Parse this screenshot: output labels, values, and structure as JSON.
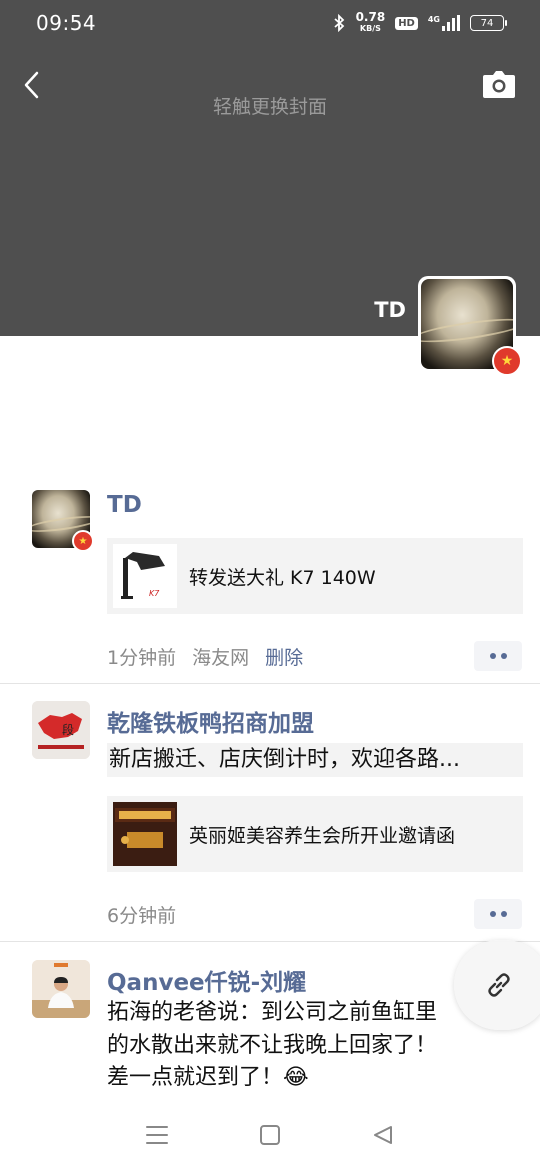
{
  "status_bar": {
    "time": "09:54",
    "net_speed_value": "0.78",
    "net_speed_unit": "KB/S",
    "hd_label": "HD",
    "network_label": "4G",
    "battery": "74"
  },
  "cover": {
    "hint": "轻触更换封面",
    "owner_name": "TD"
  },
  "posts": [
    {
      "author": "TD",
      "share_title": "转发送大礼 K7 140W",
      "time": "1分钟前",
      "source": "海友网",
      "delete_label": "删除"
    },
    {
      "author": "乾隆铁板鸭招商加盟",
      "text": "新店搬迁、店庆倒计时，欢迎各路...",
      "share_title": "英丽姬美容养生会所开业邀请函",
      "time": "6分钟前"
    },
    {
      "author": "Qanvee仟锐-刘耀",
      "text_line1": "拓海的老爸说：到公司之前鱼缸里",
      "text_line2": "的水散出来就不让我晚上回家了！",
      "text_line3": "差一点就迟到了！😂"
    }
  ],
  "colors": {
    "link_blue": "#576b95",
    "cover_bg": "#4f4f4f"
  }
}
